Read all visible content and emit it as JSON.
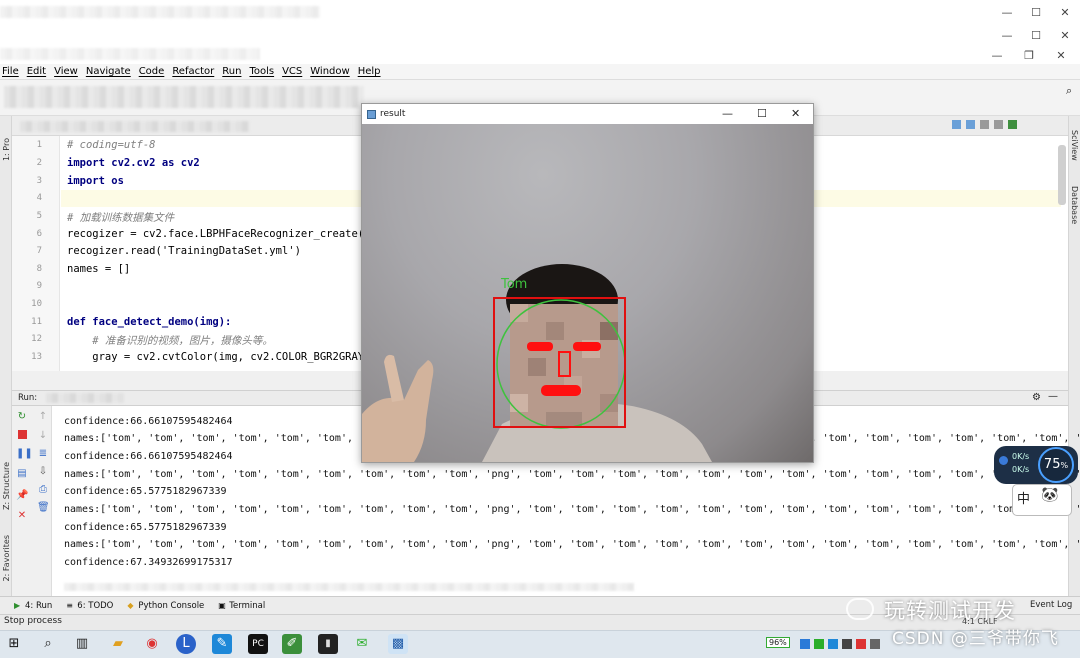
{
  "window": {
    "minimize": "—",
    "maximize": "☐",
    "close": "✕",
    "restore": "❐"
  },
  "menu": [
    "File",
    "Edit",
    "View",
    "Navigate",
    "Code",
    "Refactor",
    "Run",
    "Tools",
    "VCS",
    "Window",
    "Help"
  ],
  "left_strip": {
    "project": "1: Pro",
    "structure": "Z: Structure",
    "favorites": "2: Favorites"
  },
  "right_strip": {
    "sciview": "SciView",
    "database": "Database"
  },
  "editor": {
    "lines": [
      {
        "n": "1",
        "code": "# coding=utf-8"
      },
      {
        "n": "2",
        "code": "import cv2.cv2 as cv2"
      },
      {
        "n": "3",
        "code": "import os"
      },
      {
        "n": "4",
        "code": ""
      },
      {
        "n": "5",
        "code": "# 加载训练数据集文件"
      },
      {
        "n": "6",
        "code": "recogizer = cv2.face.LBPHFaceRecognizer_create()"
      },
      {
        "n": "7",
        "code": "recogizer.read('TrainingDataSet.yml')"
      },
      {
        "n": "8",
        "code": "names = []"
      },
      {
        "n": "9",
        "code": ""
      },
      {
        "n": "10",
        "code": ""
      },
      {
        "n": "11",
        "code": "def face_detect_demo(img):"
      },
      {
        "n": "12",
        "code": "    # 准备识别的视频，图片，摄像头等。"
      },
      {
        "n": "13",
        "code": "    gray = cv2.cvtColor(img, cv2.COLOR_BGR2GRAY)  #"
      }
    ]
  },
  "run": {
    "label": "Run:",
    "output": [
      "confidence:66.66107595482464",
      "names:['tom', 'tom', 'tom', 'tom', 'tom', 'tom', 'tom', 'tom', 'tom', 'png', 'tom', 'tom', 'tom', 'tom', 'tom', 'tom', 'tom', 'tom', 'tom', 'tom', 'tom', 'tom', 'tom', 'tom', 'to",
      "confidence:66.66107595482464",
      "names:['tom', 'tom', 'tom', 'tom', 'tom', 'tom', 'tom', 'tom', 'tom', 'png', 'tom', 'tom', 'tom', 'tom', 'tom', 'tom', 'tom', 'tom', 'tom', 'tom', 'tom', 'tom', 'tom', 'tom', 'to",
      "confidence:65.5775182967339",
      "names:['tom', 'tom', 'tom', 'tom', 'tom', 'tom', 'tom', 'tom', 'tom', 'png', 'tom', 'tom', 'tom', 'tom', 'tom', 'tom', 'tom', 'tom', 'tom', 'tom', 'tom', 'tom', 'tom', 'tom', 'to",
      "confidence:65.5775182967339",
      "names:['tom', 'tom', 'tom', 'tom', 'tom', 'tom', 'tom', 'tom', 'tom', 'png', 'tom', 'tom', 'tom', 'tom', 'tom', 'tom', 'tom', 'tom', 'tom', 'tom', 'tom', 'tom', 'tom', 'tom', 'to",
      "confidence:67.34932699175317"
    ]
  },
  "tooltabs": [
    {
      "icon": "▶",
      "label": "4: Run"
    },
    {
      "icon": "≡",
      "label": "6: TODO"
    },
    {
      "icon": "◆",
      "label": "Python Console"
    },
    {
      "icon": "▣",
      "label": "Terminal"
    }
  ],
  "event_log": "Event Log",
  "status": {
    "left": "Stop process",
    "right": "4:1  CRLF"
  },
  "result_window": {
    "title": "result",
    "face_label": "Tom",
    "colors": {
      "box": "#e01010",
      "circle": "#3ec23e",
      "label": "#3ec23e"
    }
  },
  "net_widget": {
    "up": "0K/s",
    "down": "0K/s",
    "cpu": "75",
    "cpu_unit": "%"
  },
  "ime": {
    "label": "中"
  },
  "tray": {
    "battery": "96%"
  },
  "watermark": {
    "wechat": "玩转测试开发",
    "csdn": "CSDN @三爷带你飞"
  }
}
